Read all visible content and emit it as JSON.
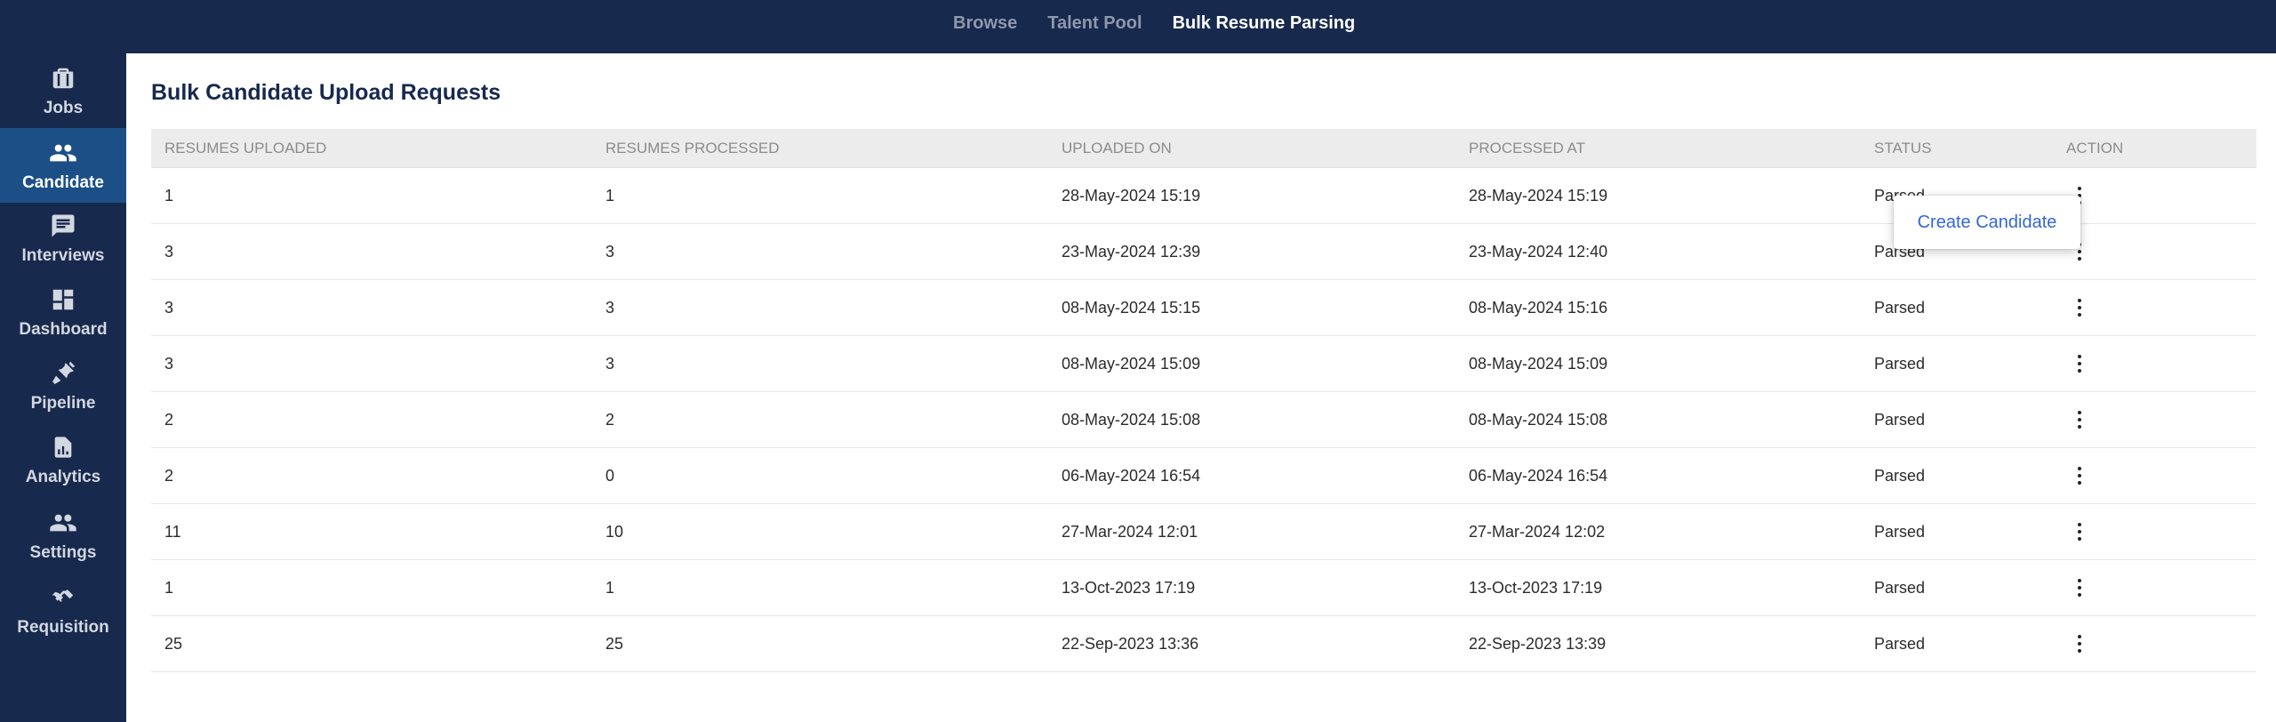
{
  "top_nav": {
    "tabs": [
      {
        "label": "Browse"
      },
      {
        "label": "Talent Pool"
      },
      {
        "label": "Bulk Resume Parsing"
      }
    ],
    "active": "Bulk Resume Parsing"
  },
  "sidebar": {
    "items": [
      {
        "label": "Jobs",
        "icon": "briefcase-icon"
      },
      {
        "label": "Candidate",
        "icon": "people-icon"
      },
      {
        "label": "Interviews",
        "icon": "chat-icon"
      },
      {
        "label": "Dashboard",
        "icon": "dashboard-icon"
      },
      {
        "label": "Pipeline",
        "icon": "pipeline-icon"
      },
      {
        "label": "Analytics",
        "icon": "analytics-icon"
      },
      {
        "label": "Settings",
        "icon": "people-settings-icon"
      },
      {
        "label": "Requisition",
        "icon": "handshake-icon"
      }
    ],
    "active": "Candidate"
  },
  "page": {
    "title": "Bulk Candidate Upload Requests"
  },
  "table": {
    "headers": [
      "RESUMES UPLOADED",
      "RESUMES PROCESSED",
      "UPLOADED ON",
      "PROCESSED AT",
      "STATUS",
      "ACTION"
    ],
    "rows": [
      {
        "uploaded": "1",
        "processed": "1",
        "uploaded_on": "28-May-2024 15:19",
        "processed_at": "28-May-2024 15:19",
        "status": "Parsed"
      },
      {
        "uploaded": "3",
        "processed": "3",
        "uploaded_on": "23-May-2024 12:39",
        "processed_at": "23-May-2024 12:40",
        "status": "Parsed"
      },
      {
        "uploaded": "3",
        "processed": "3",
        "uploaded_on": "08-May-2024 15:15",
        "processed_at": "08-May-2024 15:16",
        "status": "Parsed"
      },
      {
        "uploaded": "3",
        "processed": "3",
        "uploaded_on": "08-May-2024 15:09",
        "processed_at": "08-May-2024 15:09",
        "status": "Parsed"
      },
      {
        "uploaded": "2",
        "processed": "2",
        "uploaded_on": "08-May-2024 15:08",
        "processed_at": "08-May-2024 15:08",
        "status": "Parsed"
      },
      {
        "uploaded": "2",
        "processed": "0",
        "uploaded_on": "06-May-2024 16:54",
        "processed_at": "06-May-2024 16:54",
        "status": "Parsed"
      },
      {
        "uploaded": "11",
        "processed": "10",
        "uploaded_on": "27-Mar-2024 12:01",
        "processed_at": "27-Mar-2024 12:02",
        "status": "Parsed"
      },
      {
        "uploaded": "1",
        "processed": "1",
        "uploaded_on": "13-Oct-2023 17:19",
        "processed_at": "13-Oct-2023 17:19",
        "status": "Parsed"
      },
      {
        "uploaded": "25",
        "processed": "25",
        "uploaded_on": "22-Sep-2023 13:36",
        "processed_at": "22-Sep-2023 13:39",
        "status": "Parsed"
      }
    ]
  },
  "action_menu": {
    "items": [
      {
        "label": "Create Candidate"
      }
    ]
  },
  "colors": {
    "nav_bg": "#17294d",
    "sidebar_active": "#1c4f86",
    "link": "#3367d6",
    "header_bg": "#ececec"
  }
}
